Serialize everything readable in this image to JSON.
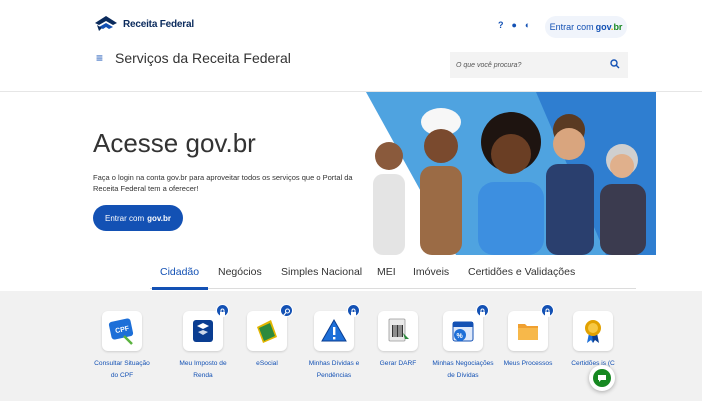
{
  "header": {
    "logo_text": "Receita Federal",
    "site_title": "Serviços da Receita Federal",
    "menu_icon": "≡",
    "help_icon": "?",
    "accessibility_icon": "●",
    "contrast_icon": "◐",
    "login_label": "Entrar com",
    "search_placeholder": "O que você procura?",
    "search_icon": "⚲"
  },
  "govbr": {
    "g": "gov",
    "dot": ".",
    "br": "br"
  },
  "hero": {
    "title": "Acesse gov.br",
    "description": "Faça o login na conta gov.br para aproveitar todos os serviços que o Portal da Receita Federal tem a oferecer!",
    "button_label": "Entrar com",
    "button_brand": "gov.br"
  },
  "tabs": [
    {
      "label": "Cidadão",
      "active": true
    },
    {
      "label": "Negócios"
    },
    {
      "label": "Simples Nacional"
    },
    {
      "label": "MEI"
    },
    {
      "label": "Imóveis"
    },
    {
      "label": "Certidões e Validações"
    }
  ],
  "services": [
    {
      "label": "Consultar Situação do CPF",
      "icon": "cpf-card-icon",
      "locked": false
    },
    {
      "label": "Meu Imposto de Renda",
      "icon": "tax-form-icon",
      "locked": true
    },
    {
      "label": "eSocial",
      "icon": "esocial-icon",
      "locked": true
    },
    {
      "label": "Minhas Dívidas e Pendências",
      "icon": "warning-icon",
      "locked": true
    },
    {
      "label": "Gerar DARF",
      "icon": "barcode-document-icon",
      "locked": false
    },
    {
      "label": "Minhas Negociações de Dívidas",
      "icon": "calendar-percent-icon",
      "locked": true
    },
    {
      "label": "Meus Processos",
      "icon": "folder-icon",
      "locked": true
    },
    {
      "label": "Certidões is (C",
      "icon": "medal-icon",
      "locked": false
    }
  ],
  "colors": {
    "brand": "#1351b4",
    "govbr_yellow": "#f2a900",
    "govbr_green": "#168821",
    "hero_blue": "#4fa3e0"
  }
}
